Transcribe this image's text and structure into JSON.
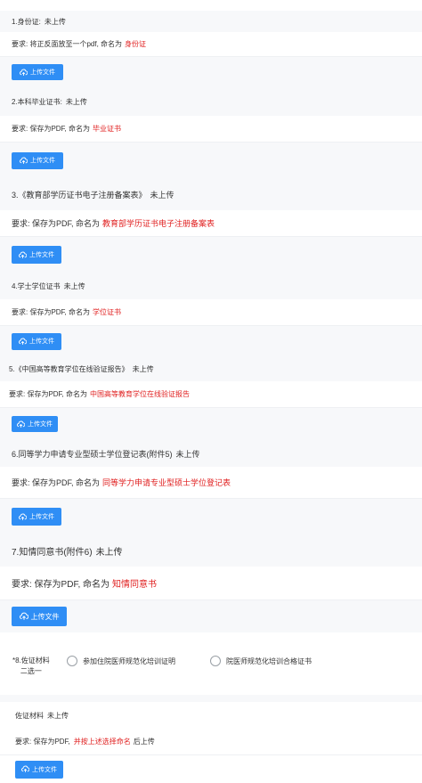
{
  "sections": [
    {
      "title": "1.身份证:",
      "status": "未上传",
      "req_prefix": "要求: 将正反面放至一个pdf, 命名为",
      "req_name": "身份证",
      "button": "上传文件"
    },
    {
      "title": "2.本科毕业证书:",
      "status": "未上传",
      "req_prefix": "要求: 保存为PDF, 命名为",
      "req_name": "毕业证书",
      "button": "上传文件"
    },
    {
      "title": "3.《教育部学历证书电子注册备案表》",
      "status": "未上传",
      "req_prefix": "要求: 保存为PDF, 命名为",
      "req_name": "教育部学历证书电子注册备案表",
      "button": "上传文件"
    },
    {
      "title": "4.学士学位证书",
      "status": "未上传",
      "req_prefix": "要求: 保存为PDF, 命名为",
      "req_name": "学位证书",
      "button": "上传文件"
    },
    {
      "title": "5.《中国高等教育学位在线验证报告》",
      "status": "未上传",
      "req_prefix": "要求: 保存为PDF, 命名为",
      "req_name": "中国高等教育学位在线验证报告",
      "button": "上传文件"
    },
    {
      "title": "6.同等学力申请专业型硕士学位登记表(附件5)",
      "status": "未上传",
      "req_prefix": "要求: 保存为PDF, 命名为",
      "req_name": "同等学力申请专业型硕士学位登记表",
      "button": "上传文件"
    },
    {
      "title": "7.知情同意书(附件6)",
      "status": "未上传",
      "req_prefix": "要求: 保存为PDF, 命名为",
      "req_name": "知情同意书",
      "button": "上传文件"
    }
  ],
  "item8": {
    "label_line1": "*8.佐证材料",
    "label_line2": "二选一",
    "option1": "参加住院医师规范化培训证明",
    "option2": "院医师规范化培训合格证书"
  },
  "evidence": {
    "title": "佐证材料",
    "status": "未上传",
    "req_prefix": "要求: 保存为PDF,",
    "req_highlight": "并按上述选择命名",
    "req_suffix": "后上传",
    "button": "上传文件"
  },
  "colors": {
    "accent": "#2f8ef5",
    "highlight": "#e02020"
  },
  "icons": {
    "upload": "cloud-upload-icon"
  }
}
